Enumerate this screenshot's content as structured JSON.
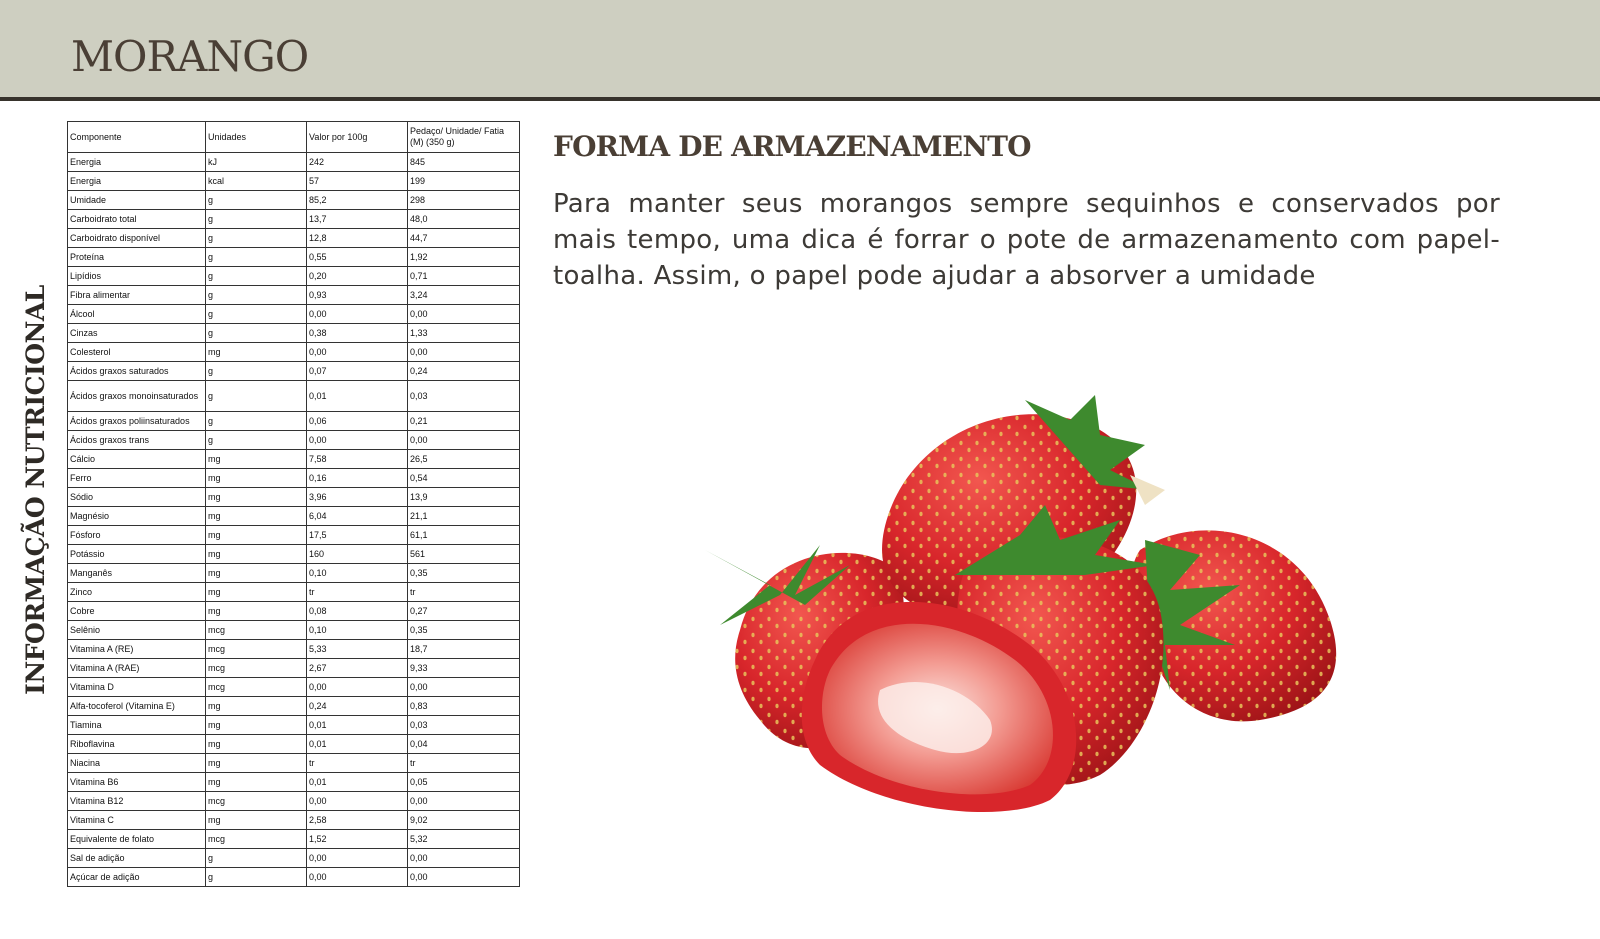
{
  "header": {
    "title": "MORANGO"
  },
  "side_title": "INFORMAÇÃO NUTRICIONAL",
  "table": {
    "headers": [
      "Componente",
      "Unidades",
      "Valor por 100g",
      "Pedaço/ Unidade/ Fatia (M) (350 g)"
    ],
    "rows": [
      [
        "Energia",
        "kJ",
        "242",
        "845"
      ],
      [
        "Energia",
        "kcal",
        "57",
        "199"
      ],
      [
        "Umidade",
        "g",
        "85,2",
        "298"
      ],
      [
        "Carboidrato total",
        "g",
        "13,7",
        "48,0"
      ],
      [
        "Carboidrato disponível",
        "g",
        "12,8",
        "44,7"
      ],
      [
        "Proteína",
        "g",
        "0,55",
        "1,92"
      ],
      [
        "Lipídios",
        "g",
        "0,20",
        "0,71"
      ],
      [
        "Fibra alimentar",
        "g",
        "0,93",
        "3,24"
      ],
      [
        "Álcool",
        "g",
        "0,00",
        "0,00"
      ],
      [
        "Cinzas",
        "g",
        "0,38",
        "1,33"
      ],
      [
        "Colesterol",
        "mg",
        "0,00",
        "0,00"
      ],
      [
        "Ácidos graxos saturados",
        "g",
        "0,07",
        "0,24"
      ],
      [
        "Ácidos graxos monoinsaturados",
        "g",
        "0,01",
        "0,03"
      ],
      [
        "Ácidos graxos poliinsaturados",
        "g",
        "0,06",
        "0,21"
      ],
      [
        "Ácidos graxos trans",
        "g",
        "0,00",
        "0,00"
      ],
      [
        "Cálcio",
        "mg",
        "7,58",
        "26,5"
      ],
      [
        "Ferro",
        "mg",
        "0,16",
        "0,54"
      ],
      [
        "Sódio",
        "mg",
        "3,96",
        "13,9"
      ],
      [
        "Magnésio",
        "mg",
        "6,04",
        "21,1"
      ],
      [
        "Fósforo",
        "mg",
        "17,5",
        "61,1"
      ],
      [
        "Potássio",
        "mg",
        "160",
        "561"
      ],
      [
        "Manganês",
        "mg",
        "0,10",
        "0,35"
      ],
      [
        "Zinco",
        "mg",
        "tr",
        "tr"
      ],
      [
        "Cobre",
        "mg",
        "0,08",
        "0,27"
      ],
      [
        "Selênio",
        "mcg",
        "0,10",
        "0,35"
      ],
      [
        "Vitamina A (RE)",
        "mcg",
        "5,33",
        "18,7"
      ],
      [
        "Vitamina A (RAE)",
        "mcg",
        "2,67",
        "9,33"
      ],
      [
        "Vitamina D",
        "mcg",
        "0,00",
        "0,00"
      ],
      [
        "Alfa-tocoferol (Vitamina E)",
        "mg",
        "0,24",
        "0,83"
      ],
      [
        "Tiamina",
        "mg",
        "0,01",
        "0,03"
      ],
      [
        "Riboflavina",
        "mg",
        "0,01",
        "0,04"
      ],
      [
        "Niacina",
        "mg",
        "tr",
        "tr"
      ],
      [
        "Vitamina B6",
        "mg",
        "0,01",
        "0,05"
      ],
      [
        "Vitamina B12",
        "mcg",
        "0,00",
        "0,00"
      ],
      [
        "Vitamina C",
        "mg",
        "2,58",
        "9,02"
      ],
      [
        "Equivalente de folato",
        "mcg",
        "1,52",
        "5,32"
      ],
      [
        "Sal de adição",
        "g",
        "0,00",
        "0,00"
      ],
      [
        "Açúcar de adição",
        "g",
        "0,00",
        "0,00"
      ]
    ]
  },
  "storage": {
    "heading": "FORMA DE ARMAZENAMENTO",
    "text": "Para manter seus morangos sempre sequinhos e conservados por mais tempo, uma dica é forrar o pote de armazenamento com papel-toalha. Assim, o papel pode ajudar a absorver a umidade"
  },
  "image": {
    "icon": "strawberries-photo"
  },
  "colors": {
    "header_bg": "#cecfc1",
    "header_rule": "#37332c",
    "title_text": "#4a3f35",
    "strawberry_red": "#d8262b",
    "leaf_green": "#3e8a2e"
  }
}
